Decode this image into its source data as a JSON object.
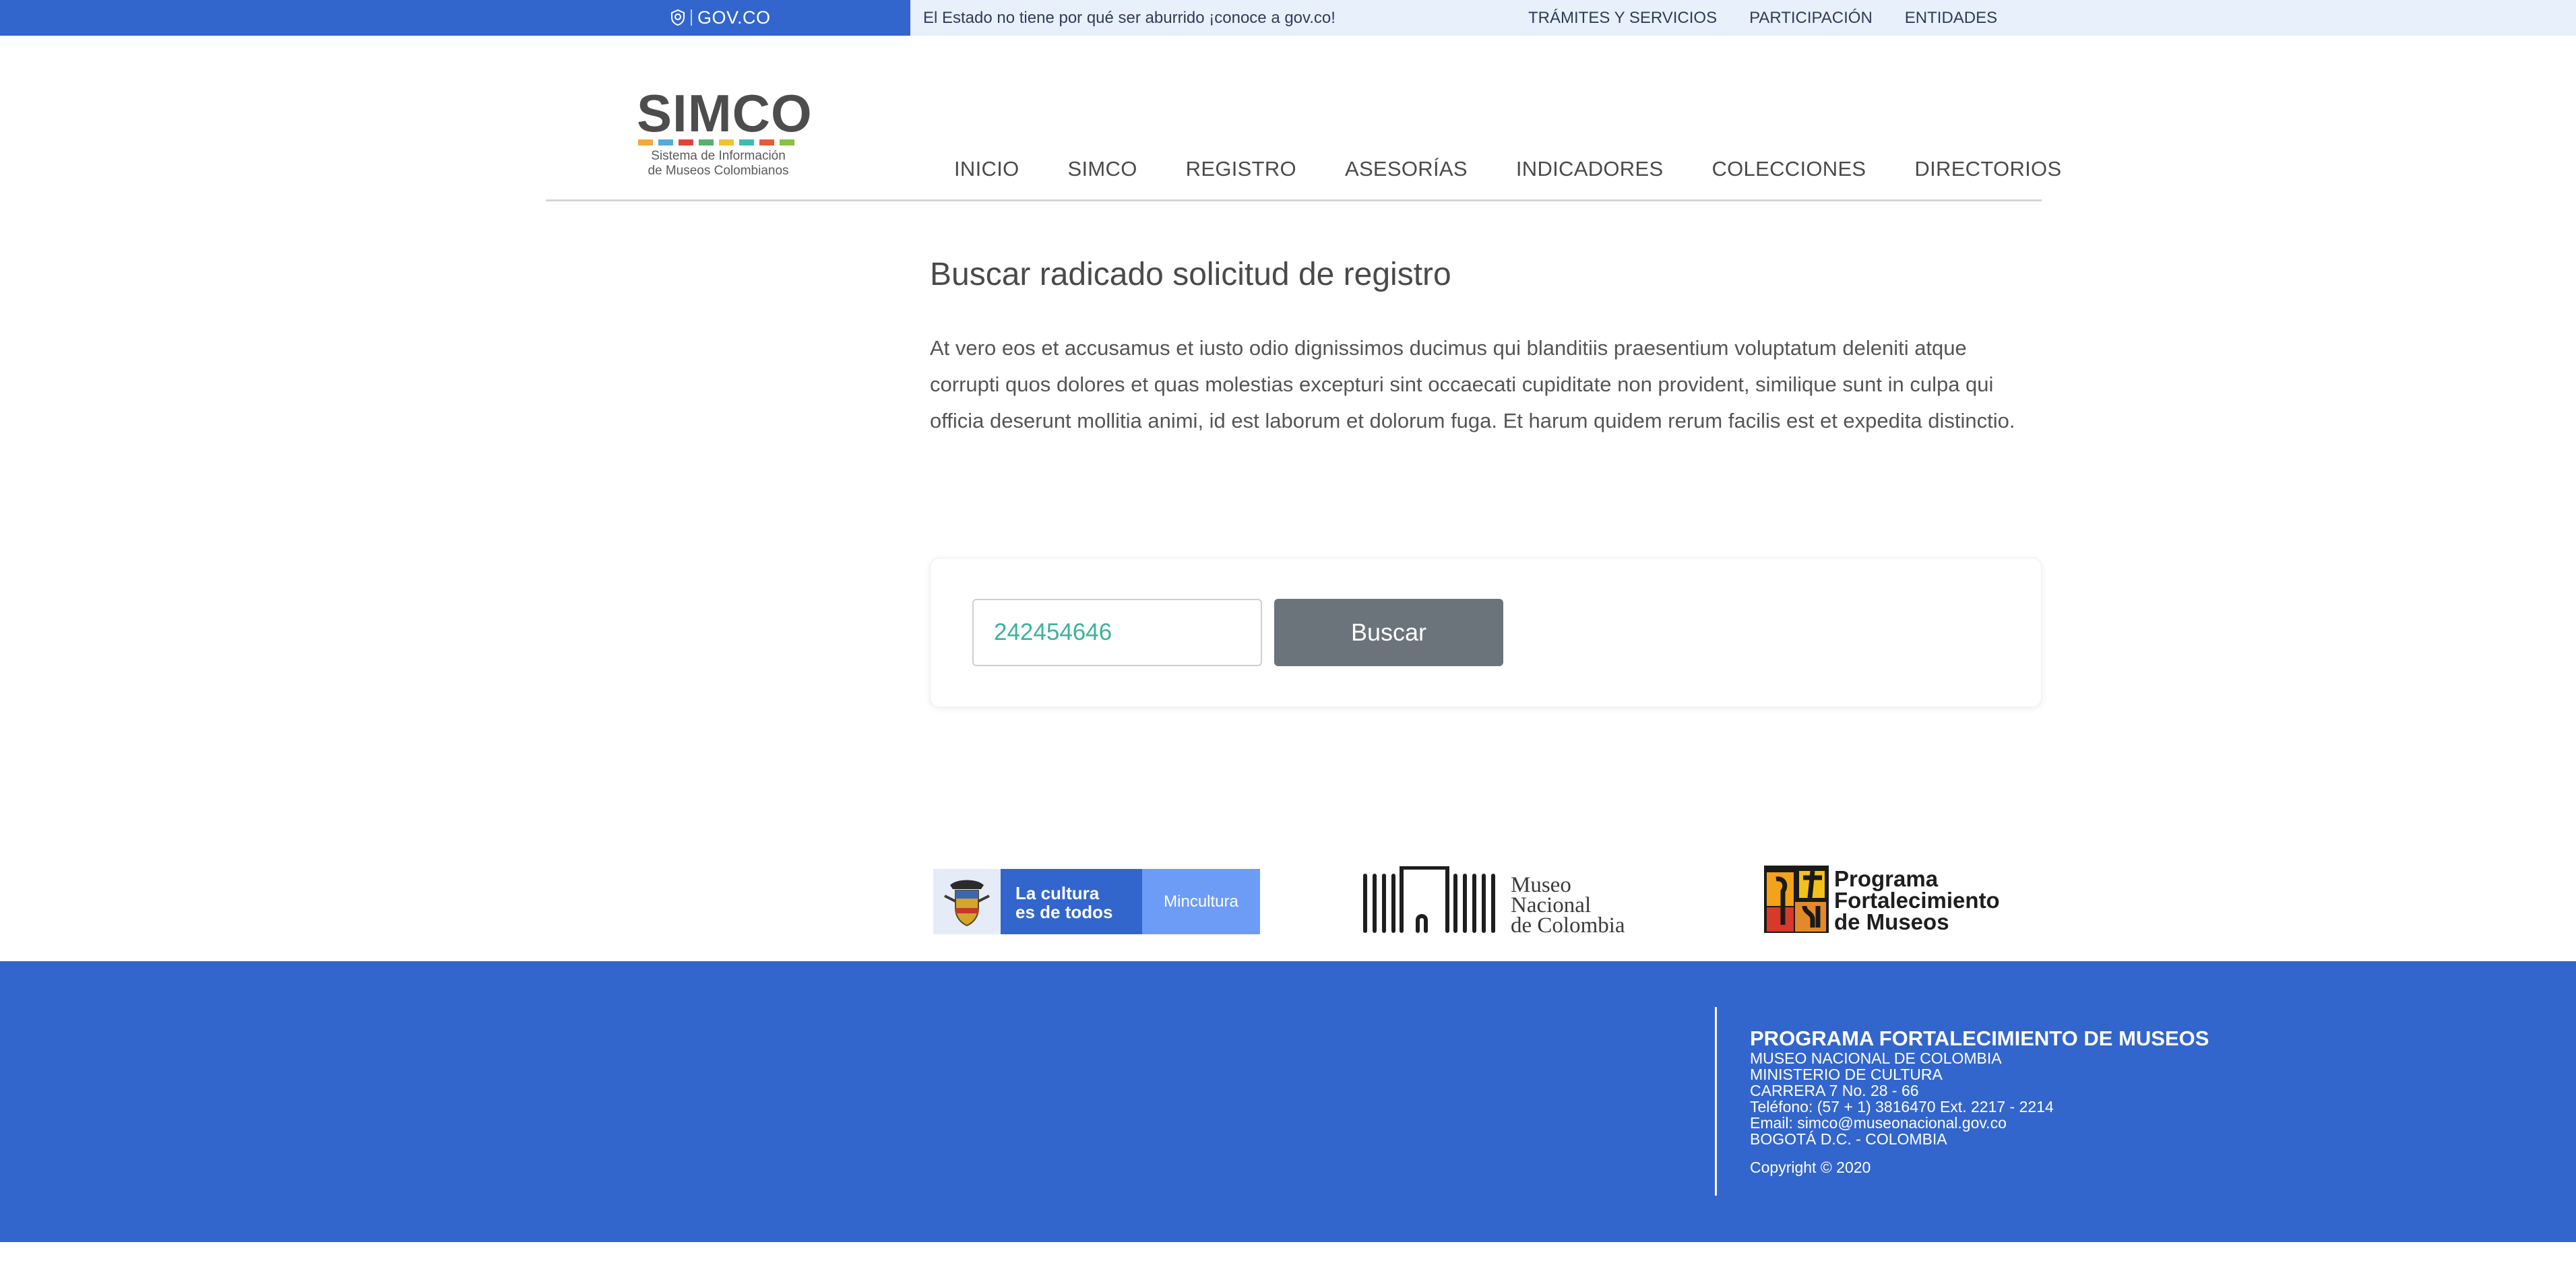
{
  "govbar": {
    "logo_text": "GOV.CO",
    "tagline": "El Estado no tiene por qué ser aburrido ¡conoce a gov.co!",
    "links": [
      "TRÁMITES Y SERVICIOS",
      "PARTICIPACIÓN",
      "ENTIDADES"
    ]
  },
  "brand": {
    "name": "SIMCO",
    "subtitle_line1": "Sistema de Información",
    "subtitle_line2": "de Museos Colombianos",
    "dot_colors": [
      "#f4a93a",
      "#55a9dc",
      "#e0453a",
      "#58b06a",
      "#f1c232",
      "#3dbcb0",
      "#e35b3a",
      "#8cbf45"
    ]
  },
  "nav": {
    "items": [
      "INICIO",
      "SIMCO",
      "REGISTRO",
      "ASESORÍAS",
      "INDICADORES",
      "COLECCIONES",
      "DIRECTORIOS"
    ]
  },
  "main": {
    "title": "Buscar radicado solicitud de registro",
    "intro": "At vero eos et accusamus et iusto odio dignissimos ducimus qui blanditiis praesentium voluptatum deleniti atque corrupti quos dolores et quas molestias excepturi sint occaecati cupiditate non provident, similique sunt in culpa qui officia deserunt mollitia animi, id est laborum et dolorum fuga. Et harum quidem rerum facilis est et expedita distinctio.",
    "search_value": "242454646",
    "search_button": "Buscar"
  },
  "partners": {
    "mincultura_slogan_line1": "La cultura",
    "mincultura_slogan_line2": "es de todos",
    "mincultura_label": "Mincultura",
    "museo_line1": "Museo",
    "museo_line2": "Nacional",
    "museo_line3": "de Colombia",
    "programa_line1": "Programa",
    "programa_line2": "Fortalecimiento",
    "programa_line3": "de Museos"
  },
  "footer": {
    "heading": "PROGRAMA FORTALECIMIENTO DE MUSEOS",
    "lines": [
      "MUSEO NACIONAL DE COLOMBIA",
      "MINISTERIO DE CULTURA",
      "CARRERA 7 No. 28 - 66",
      "Teléfono: (57 + 1) 3816470 Ext. 2217 - 2214",
      "Email: simco@museonacional.gov.co",
      "BOGOTÁ D.C. - COLOMBIA"
    ],
    "copyright": "Copyright © 2020"
  },
  "colors": {
    "gov_blue": "#3366cc",
    "gov_light": "#e8f0fb",
    "button_gray": "#6b737b",
    "input_text": "#3bb39a"
  }
}
